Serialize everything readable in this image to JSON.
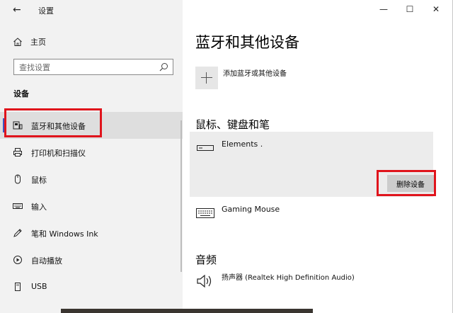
{
  "window": {
    "title": "设置",
    "controls": {
      "minimize": "—",
      "maximize": "☐",
      "close": "✕"
    }
  },
  "sidebar": {
    "back_icon": "back-arrow-icon",
    "home_label": "主页",
    "search_placeholder": "查找设置",
    "section_label": "设备",
    "items": [
      {
        "label": "蓝牙和其他设备",
        "icon": "bluetooth-devices-icon",
        "selected": true
      },
      {
        "label": "打印机和扫描仪",
        "icon": "printer-icon",
        "selected": false
      },
      {
        "label": "鼠标",
        "icon": "mouse-icon",
        "selected": false
      },
      {
        "label": "输入",
        "icon": "keyboard-icon",
        "selected": false
      },
      {
        "label": "笔和 Windows Ink",
        "icon": "pen-icon",
        "selected": false
      },
      {
        "label": "自动播放",
        "icon": "autoplay-icon",
        "selected": false
      },
      {
        "label": "USB",
        "icon": "usb-icon",
        "selected": false
      }
    ]
  },
  "main": {
    "title": "蓝牙和其他设备",
    "add_device_label": "添加蓝牙或其他设备",
    "mouse_section": {
      "heading": "鼠标、键盘和笔",
      "devices": [
        {
          "name": "Elements .",
          "icon": "usb-drive-icon",
          "selected": true
        },
        {
          "name": "Gaming Mouse",
          "icon": "keyboard-icon",
          "selected": false
        }
      ],
      "remove_button": "删除设备"
    },
    "audio_section": {
      "heading": "音频",
      "devices": [
        {
          "name": "扬声器 (Realtek High Definition Audio)",
          "icon": "speaker-icon"
        }
      ]
    }
  },
  "colors": {
    "accent": "#3d57c2",
    "highlight_red": "#e0141c",
    "sidebar_bg": "#f2f2f2",
    "selected_bg": "#dedede",
    "card_bg": "#ececec",
    "button_bg": "#cccccc"
  }
}
